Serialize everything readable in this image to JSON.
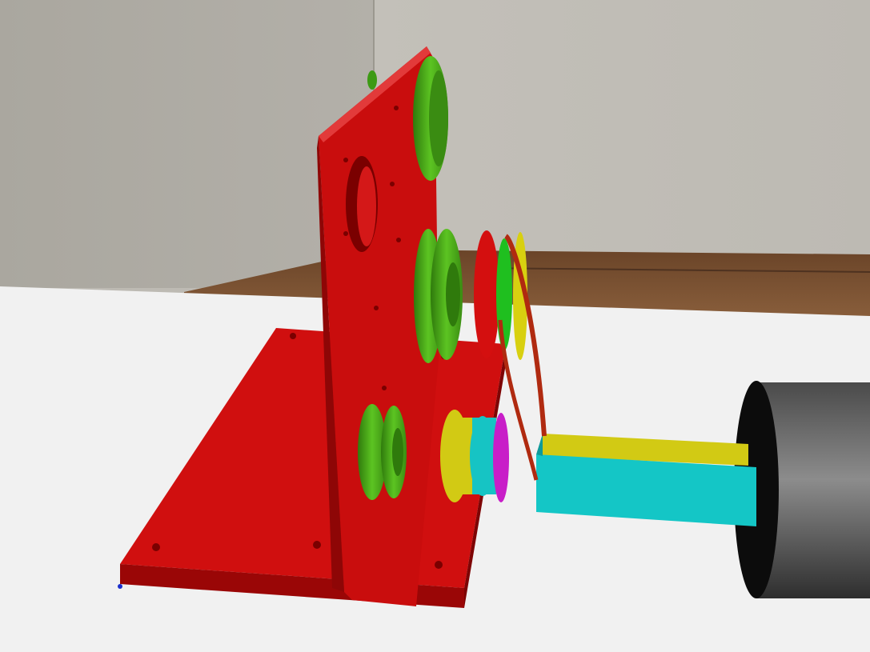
{
  "scene": {
    "kind": "3d-render",
    "description_labels": [],
    "colors": {
      "wall": "#bab7b0",
      "wall_shadow": "#9e9b95",
      "floor": "#6e4a2e",
      "table": "#f2f2f2",
      "bracket": "#cc0e0e",
      "bracket_dark": "#8a0505",
      "pulley_green": "#4fb21a",
      "pulley_green_dark": "#2f7a0c",
      "yellow": "#d4cc12",
      "cyan": "#14c8c8",
      "magenta": "#cc22cc",
      "motor": "#3a3a3a",
      "motor_face": "#0d0d0d",
      "belt": "#b02a10"
    }
  }
}
